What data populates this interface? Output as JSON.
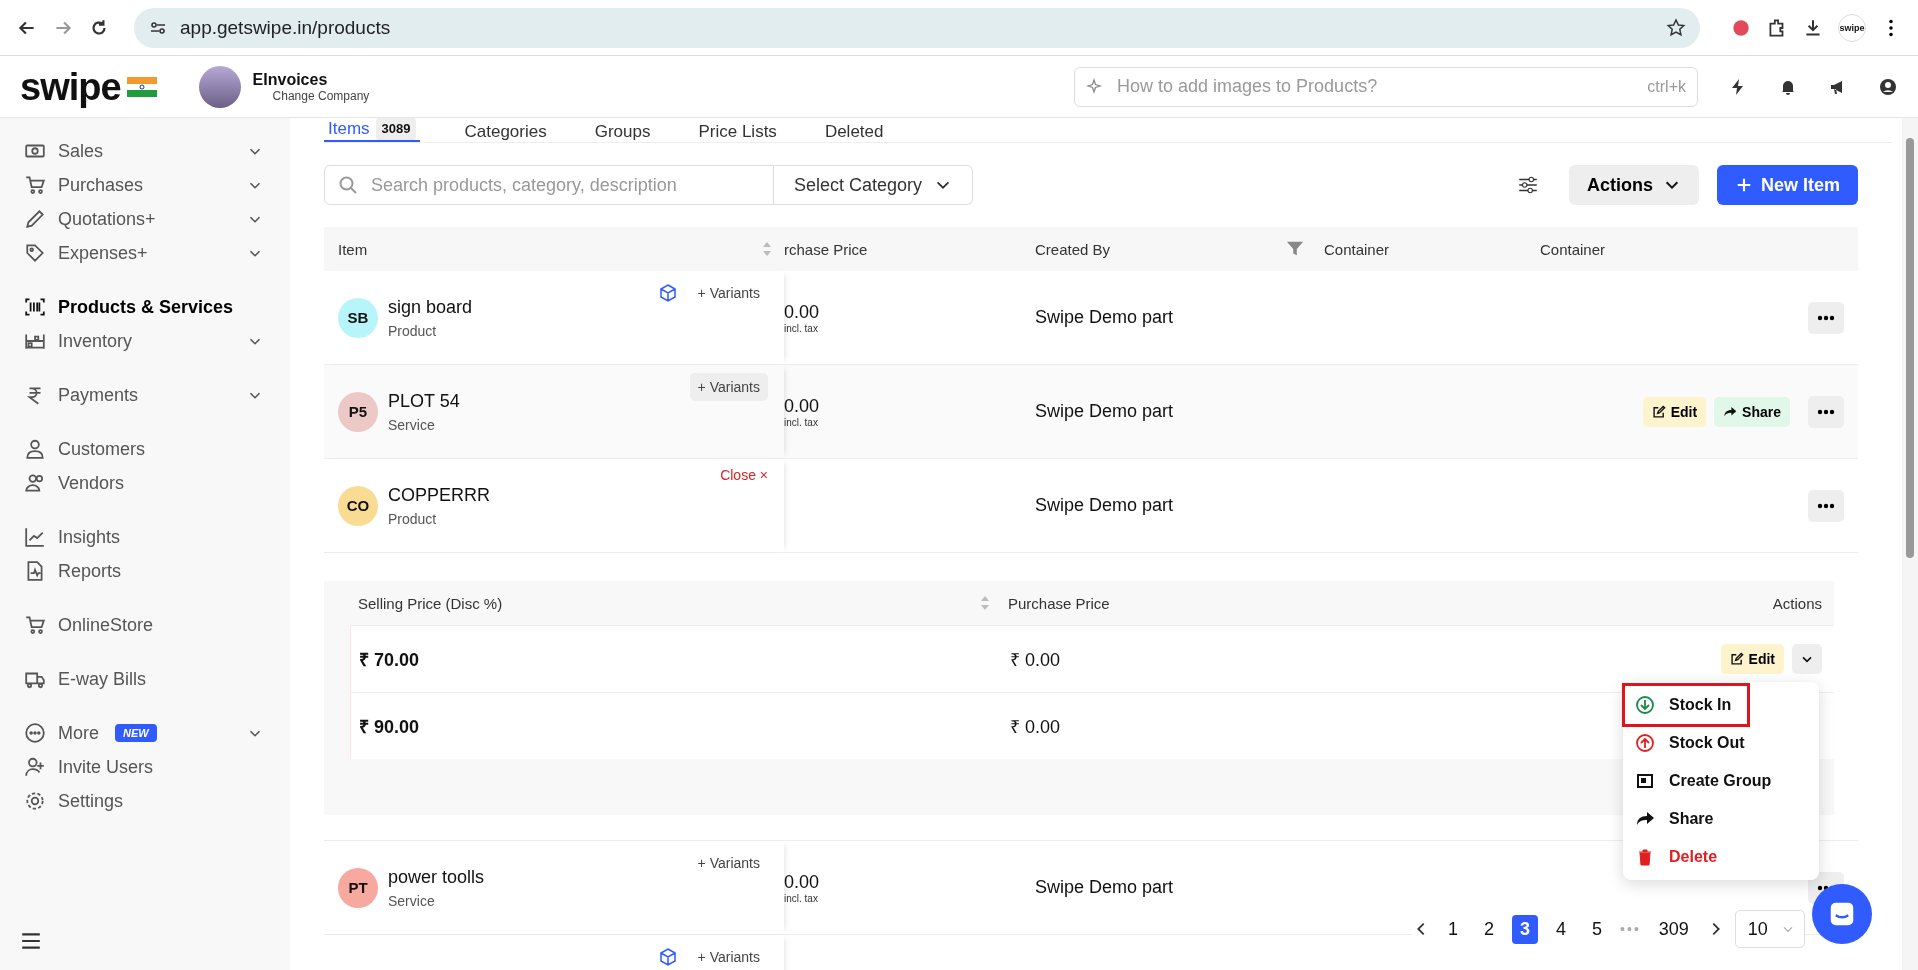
{
  "browser": {
    "url": "app.getswipe.in/products",
    "profile_label": "swipe"
  },
  "header": {
    "logo": "swipe",
    "company": "EInvoices",
    "change_company": "Change Company",
    "search_placeholder": "How to add images to Products?",
    "shortcut": "ctrl+k"
  },
  "sidebar": {
    "groups": [
      [
        {
          "label": "Sales",
          "submenu": true,
          "selected": false
        },
        {
          "label": "Purchases",
          "submenu": true,
          "selected": false
        },
        {
          "label": "Quotations+",
          "submenu": true,
          "selected": false
        },
        {
          "label": "Expenses+",
          "submenu": true,
          "selected": false
        }
      ],
      [
        {
          "label": "Products & Services",
          "submenu": false,
          "selected": true
        },
        {
          "label": "Inventory",
          "submenu": true,
          "selected": false
        }
      ],
      [
        {
          "label": "Payments",
          "submenu": true,
          "selected": false
        }
      ],
      [
        {
          "label": "Customers",
          "submenu": false,
          "selected": false
        },
        {
          "label": "Vendors",
          "submenu": false,
          "selected": false
        }
      ],
      [
        {
          "label": "Insights",
          "submenu": false,
          "selected": false
        },
        {
          "label": "Reports",
          "submenu": false,
          "selected": false
        }
      ],
      [
        {
          "label": "OnlineStore",
          "submenu": false,
          "selected": false
        }
      ],
      [
        {
          "label": "E-way Bills",
          "submenu": false,
          "selected": false
        }
      ],
      [
        {
          "label": "More",
          "submenu": true,
          "selected": false,
          "badge": "NEW"
        },
        {
          "label": "Invite Users",
          "submenu": false,
          "selected": false
        },
        {
          "label": "Settings",
          "submenu": false,
          "selected": false
        }
      ]
    ]
  },
  "tabs": [
    {
      "label": "Items",
      "count": "3089",
      "selected": true
    },
    {
      "label": "Categories",
      "selected": false
    },
    {
      "label": "Groups",
      "selected": false
    },
    {
      "label": "Price Lists",
      "selected": false
    },
    {
      "label": "Deleted",
      "selected": false
    }
  ],
  "toolbar": {
    "search_placeholder": "Search products, category, description",
    "category": "Select Category",
    "actions": "Actions",
    "new_item": "New Item"
  },
  "table": {
    "columns": [
      "Item",
      "rchase Price",
      "Created By",
      "Container",
      "Container"
    ],
    "rows": [
      {
        "initials": "SB",
        "color": "#b8f5fa",
        "name": "sign board",
        "type": "Product",
        "variant_link": "+ Variants",
        "kind": "variants",
        "cube": true,
        "hovered": false,
        "price": "0.00",
        "tax": "incl. tax",
        "created_by": "Swipe Demo part"
      },
      {
        "initials": "P5",
        "color": "#ecc9c6",
        "name": "PLOT 54",
        "type": "Service",
        "variant_link": "+ Variants",
        "kind": "variants",
        "cube": false,
        "hovered": true,
        "price": "0.00",
        "tax": "incl. tax",
        "created_by": "Swipe Demo part",
        "edit": "Edit",
        "share": "Share"
      },
      {
        "initials": "CO",
        "color": "#fadb93",
        "name": "COPPERRR",
        "type": "Product",
        "variant_link": "Close ×",
        "kind": "close",
        "cube": false,
        "hovered": false,
        "created_by": "Swipe Demo part"
      }
    ],
    "variants": {
      "columns": [
        "Selling Price (Disc %)",
        "Purchase Price",
        "Actions"
      ],
      "rows": [
        {
          "selling": "₹ 70.00",
          "purchase": "₹ 0.00",
          "edit": "Edit"
        },
        {
          "selling": "₹ 90.00",
          "purchase": "₹ 0.00"
        }
      ]
    },
    "rows_after": [
      {
        "initials": "PT",
        "color": "#f7a89f",
        "name": "power toolls",
        "type": "Service",
        "variant_link": "+ Variants",
        "kind": "variants",
        "cube": false,
        "hovered": false,
        "price": "0.00",
        "tax": "incl. tax",
        "created_by": "Swipe Demo part"
      },
      {
        "variant_link": "+ Variants",
        "kind": "variants",
        "cube": true,
        "hovered": false
      }
    ]
  },
  "menu": {
    "items": [
      {
        "label": "Stock In",
        "kind": "in",
        "selected": true
      },
      {
        "label": "Stock Out",
        "kind": "out",
        "selected": false
      },
      {
        "label": "Create Group",
        "kind": "group",
        "selected": false
      },
      {
        "label": "Share",
        "kind": "share",
        "selected": false
      },
      {
        "label": "Delete",
        "kind": "delete",
        "selected": false
      }
    ]
  },
  "pagination": {
    "pages": [
      {
        "label": "1",
        "selected": false
      },
      {
        "label": "2",
        "selected": false
      },
      {
        "label": "3",
        "selected": true
      },
      {
        "label": "4",
        "selected": false
      },
      {
        "label": "5",
        "selected": false
      }
    ],
    "ellipsis": "•••",
    "last": "309",
    "page_size": "10"
  }
}
